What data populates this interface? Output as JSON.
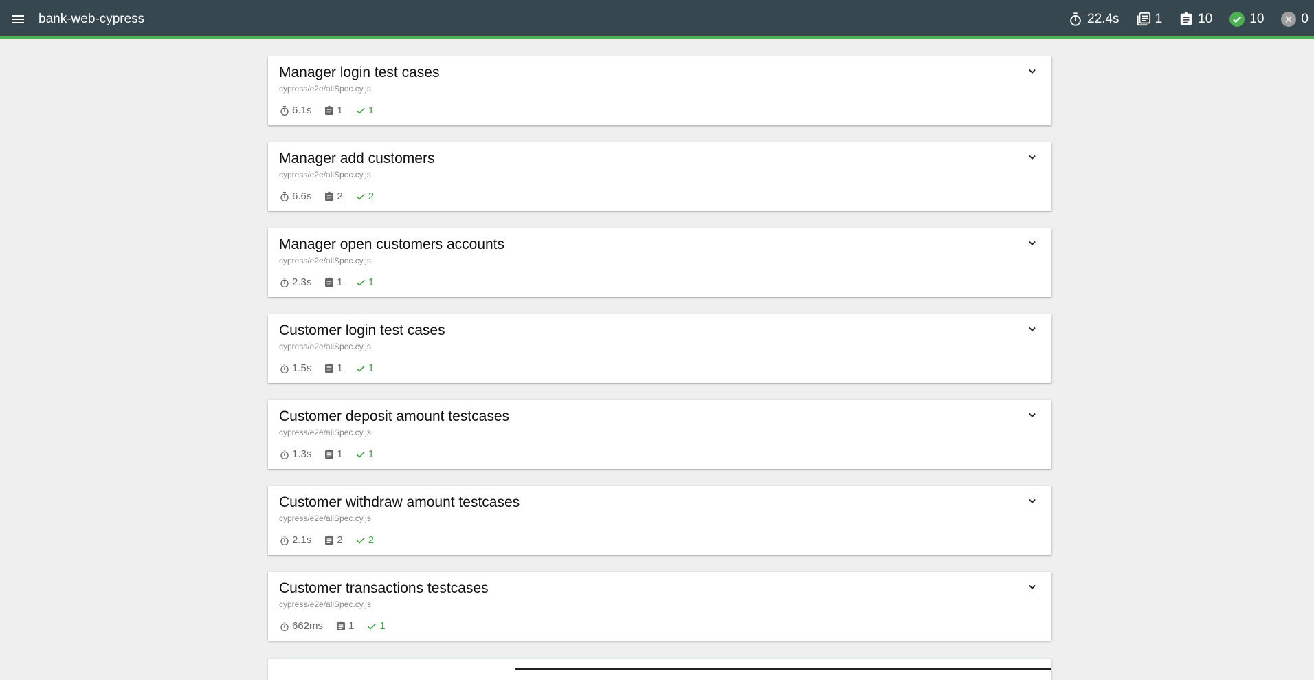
{
  "app": {
    "title": "bank-web-cypress"
  },
  "summary": {
    "duration": "22.4s",
    "suites": "1",
    "tests": "10",
    "passed": "10",
    "failed": "0"
  },
  "suites": [
    {
      "title": "Manager login test cases",
      "file": "cypress/e2e/allSpec.cy.js",
      "duration": "6.1s",
      "tests": "1",
      "passed": "1"
    },
    {
      "title": "Manager add customers",
      "file": "cypress/e2e/allSpec.cy.js",
      "duration": "6.6s",
      "tests": "2",
      "passed": "2"
    },
    {
      "title": "Manager open customers accounts",
      "file": "cypress/e2e/allSpec.cy.js",
      "duration": "2.3s",
      "tests": "1",
      "passed": "1"
    },
    {
      "title": "Customer login test cases",
      "file": "cypress/e2e/allSpec.cy.js",
      "duration": "1.5s",
      "tests": "1",
      "passed": "1"
    },
    {
      "title": "Customer deposit amount testcases",
      "file": "cypress/e2e/allSpec.cy.js",
      "duration": "1.3s",
      "tests": "1",
      "passed": "1"
    },
    {
      "title": "Customer withdraw amount testcases",
      "file": "cypress/e2e/allSpec.cy.js",
      "duration": "2.1s",
      "tests": "2",
      "passed": "2"
    },
    {
      "title": "Customer transactions testcases",
      "file": "cypress/e2e/allSpec.cy.js",
      "duration": "662ms",
      "tests": "1",
      "passed": "1"
    }
  ],
  "colors": {
    "topbar": "#37474f",
    "accent_passed": "#4caf50",
    "background": "#efefef"
  },
  "icons": {
    "menu": "menu-icon",
    "duration": "timer-icon",
    "suites": "library-books-icon",
    "tests": "assignment-icon",
    "passed": "check-circle-icon",
    "failed": "cancel-circle-icon",
    "expand": "chevron-down-icon"
  }
}
